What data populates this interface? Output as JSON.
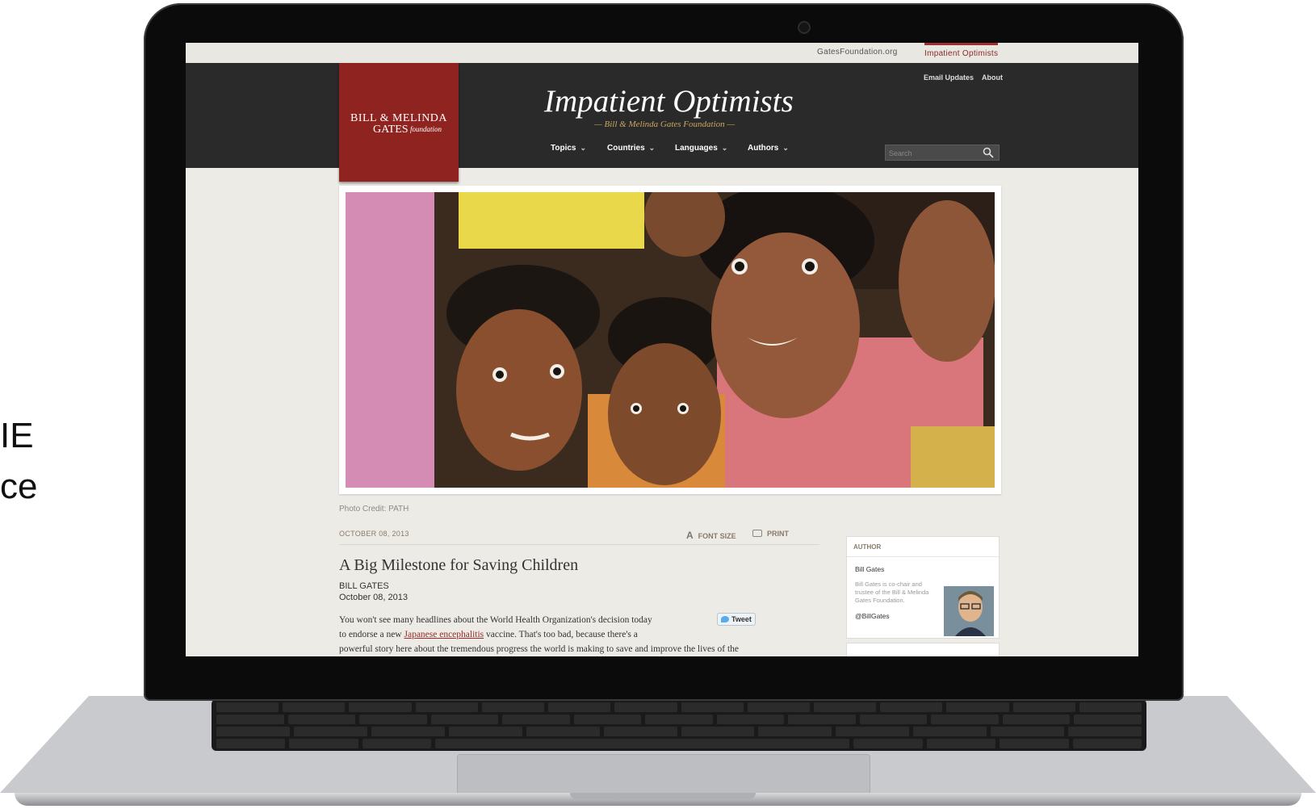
{
  "side_text": [
    "IE",
    "ce"
  ],
  "top_links": {
    "foundation": "GatesFoundation.org",
    "blog": "Impatient Optimists"
  },
  "logo": {
    "line1": "BILL & MELINDA",
    "line2": "GATES",
    "line3": "foundation"
  },
  "header": {
    "title": "Impatient Optimists",
    "subtitle": "— Bill & Melinda Gates Foundation —",
    "email_updates": "Email Updates",
    "about": "About"
  },
  "nav": [
    "Topics",
    "Countries",
    "Languages",
    "Authors"
  ],
  "search": {
    "placeholder": "Search"
  },
  "photo_credit": "Photo Credit: PATH",
  "article": {
    "dateline": "OCTOBER 08, 2013",
    "font_size": "FONT SIZE",
    "print": "PRINT",
    "headline": "A Big Milestone for Saving Children",
    "author": "BILL GATES",
    "date": "October 08, 2013",
    "body_1": "You won't see many headlines about the World Health Organization's decision today",
    "body_2a": "to endorse a new ",
    "body_link": "Japanese encephalitis",
    "body_2b": " vaccine. That's too bad, because there's a",
    "body_3": "powerful story here about the tremendous progress the world is making to save and improve the lives of the",
    "tweet": "Tweet"
  },
  "author_box": {
    "heading": "AUTHOR",
    "name": "Bill Gates",
    "bio": "Bill Gates is co-chair and trustee of the Bill & Melinda Gates Foundation.",
    "handle": "@BillGates"
  },
  "colors": {
    "accent_red": "#8f2320",
    "header_bg": "#2a2a2a",
    "page_bg": "#ecebe6",
    "subtitle_gold": "#c9a760"
  }
}
